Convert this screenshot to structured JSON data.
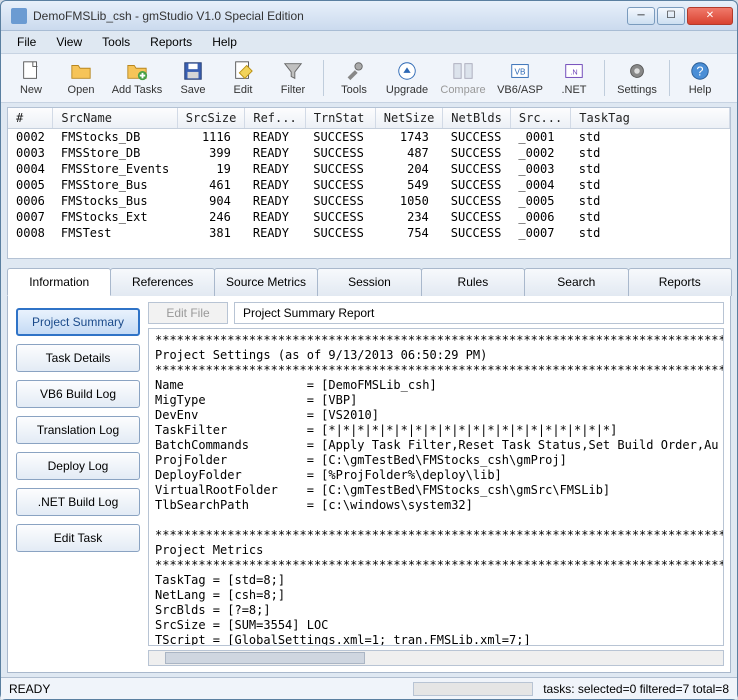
{
  "window": {
    "title": "DemoFMSLib_csh - gmStudio V1.0 Special Edition"
  },
  "menus": [
    "File",
    "View",
    "Tools",
    "Reports",
    "Help"
  ],
  "toolbar": [
    "New",
    "Open",
    "Add Tasks",
    "Save",
    "Edit",
    "Filter",
    "Tools",
    "Upgrade",
    "Compare",
    "VB6/ASP",
    ".NET",
    "Settings",
    "Help"
  ],
  "grid": {
    "headers": [
      "#",
      "SrcName",
      "SrcSize",
      "Ref...",
      "TrnStat",
      "NetSize",
      "NetBlds",
      "Src...",
      "TaskTag"
    ],
    "rows": [
      {
        "num": "0002",
        "name": "FMStocks_DB",
        "srcsize": "1116",
        "ref": "READY",
        "trn": "SUCCESS",
        "netsize": "1743",
        "netbld": "SUCCESS",
        "src": "_0001",
        "tag": "std"
      },
      {
        "num": "0003",
        "name": "FMSStore_DB",
        "srcsize": "399",
        "ref": "READY",
        "trn": "SUCCESS",
        "netsize": "487",
        "netbld": "SUCCESS",
        "src": "_0002",
        "tag": "std"
      },
      {
        "num": "0004",
        "name": "FMSStore_Events",
        "srcsize": "19",
        "ref": "READY",
        "trn": "SUCCESS",
        "netsize": "204",
        "netbld": "SUCCESS",
        "src": "_0003",
        "tag": "std"
      },
      {
        "num": "0005",
        "name": "FMSStore_Bus",
        "srcsize": "461",
        "ref": "READY",
        "trn": "SUCCESS",
        "netsize": "549",
        "netbld": "SUCCESS",
        "src": "_0004",
        "tag": "std"
      },
      {
        "num": "0006",
        "name": "FMStocks_Bus",
        "srcsize": "904",
        "ref": "READY",
        "trn": "SUCCESS",
        "netsize": "1050",
        "netbld": "SUCCESS",
        "src": "_0005",
        "tag": "std"
      },
      {
        "num": "0007",
        "name": "FMStocks_Ext",
        "srcsize": "246",
        "ref": "READY",
        "trn": "SUCCESS",
        "netsize": "234",
        "netbld": "SUCCESS",
        "src": "_0006",
        "tag": "std"
      },
      {
        "num": "0008",
        "name": "FMSTest",
        "srcsize": "381",
        "ref": "READY",
        "trn": "SUCCESS",
        "netsize": "754",
        "netbld": "SUCCESS",
        "src": "_0007",
        "tag": "std"
      }
    ]
  },
  "tabs": [
    "Information",
    "References",
    "Source Metrics",
    "Session",
    "Rules",
    "Search",
    "Reports"
  ],
  "sidebuttons": [
    "Project Summary",
    "Task Details",
    "VB6 Build Log",
    "Translation Log",
    "Deploy Log",
    ".NET Build Log",
    "Edit Task"
  ],
  "editfile": "Edit File",
  "report_title": "Project Summary Report",
  "report_body": "********************************************************************************\nProject Settings (as of 9/13/2013 06:50:29 PM)\n********************************************************************************\nName                 = [DemoFMSLib_csh]\nMigType              = [VBP]\nDevEnv               = [VS2010]\nTaskFilter           = [*|*|*|*|*|*|*|*|*|*|*|*|*|*|*|*|*|*|*|*]\nBatchCommands        = [Apply Task Filter,Reset Task Status,Set Build Order,Au\nProjFolder           = [C:\\gmTestBed\\FMStocks_csh\\gmProj]\nDeployFolder         = [%ProjFolder%\\deploy\\lib]\nVirtualRootFolder    = [C:\\gmTestBed\\FMStocks_csh\\gmSrc\\FMSLib]\nTlbSearchPath        = [c:\\windows\\system32]\n\n********************************************************************************\nProject Metrics\n********************************************************************************\nTaskTag = [std=8;]\nNetLang = [csh=8;]\nSrcBlds = [?=8;]\nSrcSize = [SUM=3554] LOC\nTScript = [GlobalSettings.xml=1; tran.FMSLib.xml=7;]\nUsrCmds = [=8;]\nRefStat = [READY=8;]\nTrnStat = [SUCCESS=8;]\nNetSize = [SUM=5020] LOC",
  "status": {
    "ready": "READY",
    "tasks": "tasks: selected=0  filtered=7  total=8"
  }
}
